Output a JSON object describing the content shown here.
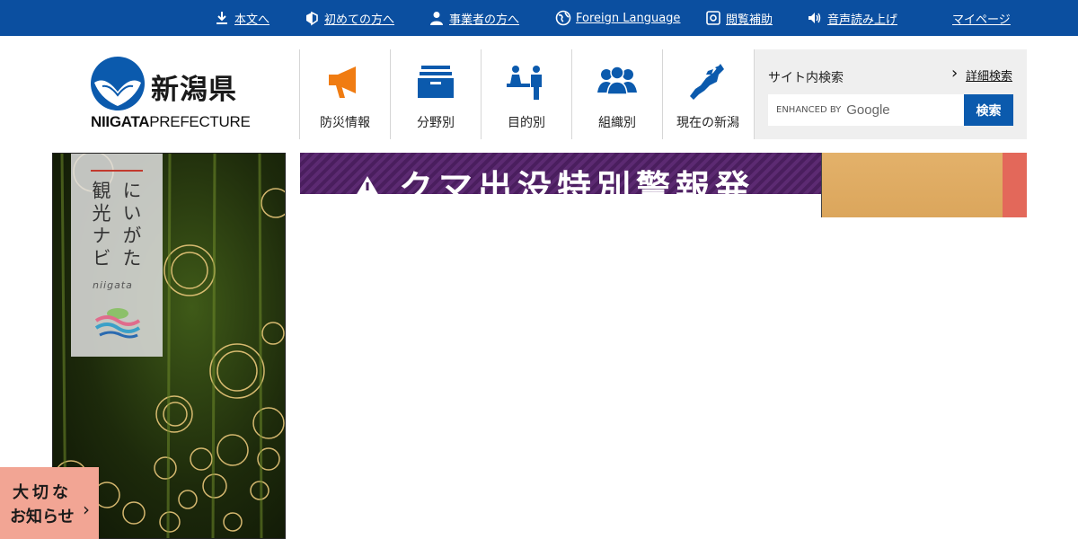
{
  "colors": {
    "topbar": "#0b4fa0",
    "brand_blue": "#0b5aad",
    "alert_purple": "#4a1e5e",
    "notice_pink": "#f2a594"
  },
  "topbar": {
    "links": [
      {
        "label": "本文へ",
        "icon": "download-arrow-icon"
      },
      {
        "label": "初めての方へ",
        "icon": "beginner-mark-icon"
      },
      {
        "label": "事業者の方へ",
        "icon": "person-icon"
      },
      {
        "label": "Foreign Language",
        "icon": "globe-icon"
      },
      {
        "label": "閲覧補助",
        "icon": "accessibility-settings-icon"
      },
      {
        "label": "音声読み上げ",
        "icon": "speaker-icon"
      },
      {
        "label": "マイページ",
        "icon": ""
      }
    ]
  },
  "logo": {
    "jp": "新潟県",
    "en_bold": "NIIGATA",
    "en_rest": "PREFECTURE"
  },
  "global_nav": [
    {
      "label": "防災情報",
      "icon": "megaphone-icon"
    },
    {
      "label": "分野別",
      "icon": "file-box-icon"
    },
    {
      "label": "目的別",
      "icon": "service-counter-icon"
    },
    {
      "label": "組織別",
      "icon": "people-group-icon"
    },
    {
      "label": "現在の新潟",
      "icon": "niigata-map-icon"
    }
  ],
  "search": {
    "title": "サイト内検索",
    "advanced_label": "詳細検索",
    "placeholder_prefix": "ENHANCED BY",
    "placeholder_brand": "Google",
    "button_label": "検索"
  },
  "tourism_banner": {
    "line1": "にいがた",
    "line2": "観光ナビ",
    "sub": "niigata"
  },
  "alert_banner": {
    "text": "クマ出没特別警報発"
  },
  "important_notice": {
    "line1": "大切な",
    "line2": "お知らせ"
  }
}
